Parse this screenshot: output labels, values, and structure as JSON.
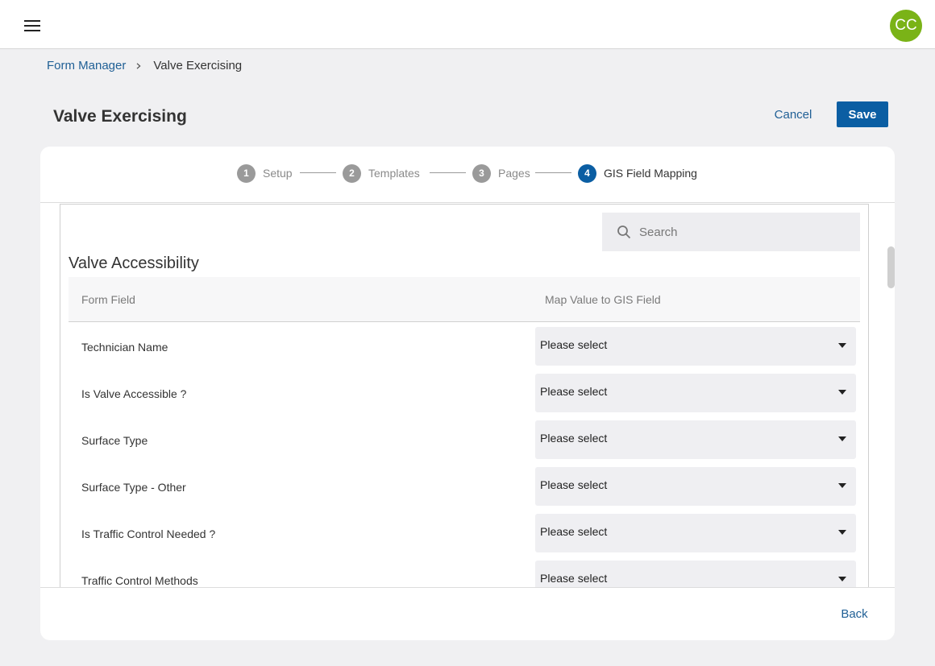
{
  "header": {
    "menu_icon": "hamburger-icon",
    "avatar_initials": "CC",
    "avatar_color": "#7ab317"
  },
  "breadcrumb": {
    "parent": "Form Manager",
    "separator_icon": "chevron-right-icon",
    "current": "Valve Exercising"
  },
  "page": {
    "title": "Valve Exercising",
    "cancel_label": "Cancel",
    "save_label": "Save",
    "accent_color": "#0b5ea3"
  },
  "stepper": {
    "steps": [
      {
        "number": "1",
        "label": "Setup",
        "active": false
      },
      {
        "number": "2",
        "label": "Templates",
        "active": false
      },
      {
        "number": "3",
        "label": "Pages",
        "active": false
      },
      {
        "number": "4",
        "label": "GIS Field Mapping",
        "active": true
      }
    ]
  },
  "search": {
    "placeholder": "Search",
    "icon": "search-icon"
  },
  "section": {
    "title": "Valve Accessibility",
    "columns": [
      "Form Field",
      "Map Value to GIS Field"
    ],
    "rows": [
      {
        "field": "Technician Name",
        "value": "Please select"
      },
      {
        "field": "Is Valve Accessible ?",
        "value": "Please select"
      },
      {
        "field": "Surface Type",
        "value": "Please select"
      },
      {
        "field": "Surface Type - Other",
        "value": "Please select"
      },
      {
        "field": "Is Traffic Control Needed ?",
        "value": "Please select"
      },
      {
        "field": "Traffic Control Methods",
        "value": "Please select"
      }
    ]
  },
  "footer": {
    "back_label": "Back"
  }
}
